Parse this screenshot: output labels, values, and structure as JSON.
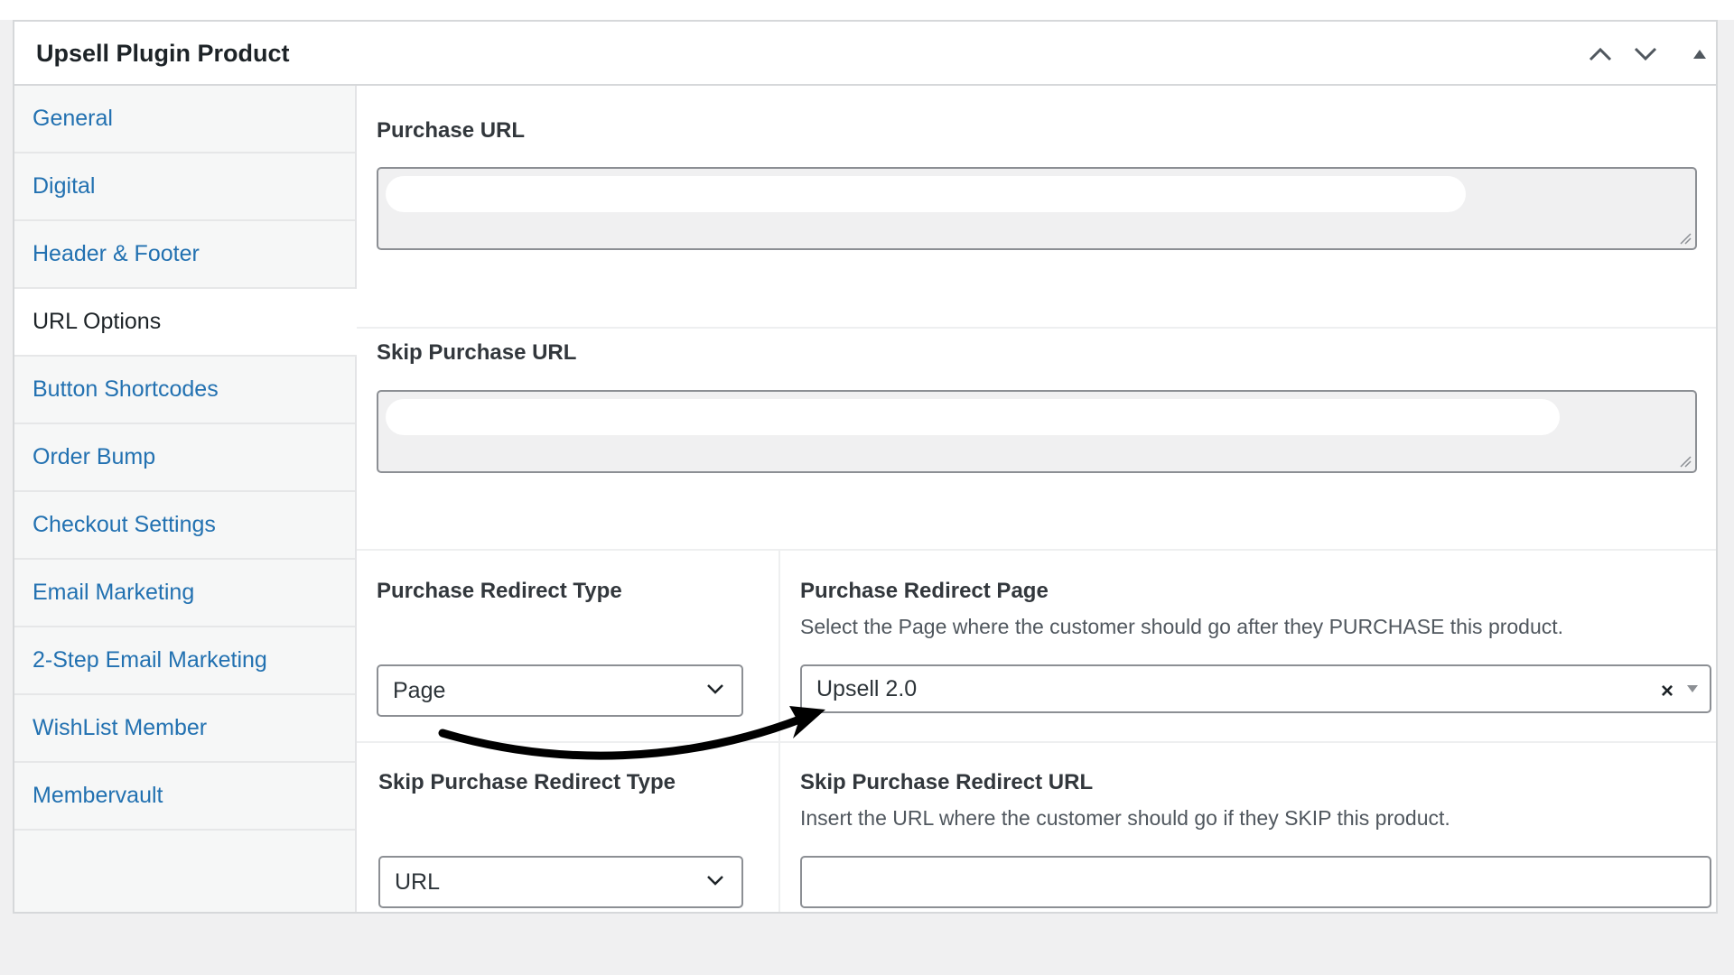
{
  "panel": {
    "title": "Upsell Plugin Product",
    "controls": [
      "move-up",
      "move-down",
      "toggle-panel"
    ]
  },
  "sidebar": {
    "tabs": [
      {
        "label": "General",
        "active": false
      },
      {
        "label": "Digital",
        "active": false
      },
      {
        "label": "Header & Footer",
        "active": false
      },
      {
        "label": "URL Options",
        "active": true
      },
      {
        "label": "Button Shortcodes",
        "active": false
      },
      {
        "label": "Order Bump",
        "active": false
      },
      {
        "label": "Checkout Settings",
        "active": false
      },
      {
        "label": "Email Marketing",
        "active": false
      },
      {
        "label": "2-Step Email Marketing",
        "active": false
      },
      {
        "label": "WishList Member",
        "active": false
      },
      {
        "label": "Membervault",
        "active": false
      }
    ]
  },
  "fields": {
    "purchase_url": {
      "label": "Purchase URL",
      "value": ""
    },
    "skip_purchase_url": {
      "label": "Skip Purchase URL",
      "value": ""
    },
    "purchase_redirect_type": {
      "label": "Purchase Redirect Type",
      "value": "Page"
    },
    "purchase_redirect_page": {
      "label": "Purchase Redirect Page",
      "description": "Select the Page where the customer should go after they PURCHASE this product.",
      "value": "Upsell 2.0",
      "clear_symbol": "×"
    },
    "skip_purchase_redirect_type": {
      "label": "Skip Purchase Redirect Type",
      "value": "URL"
    },
    "skip_purchase_redirect_url": {
      "label": "Skip Purchase Redirect URL",
      "description": "Insert the URL where the customer should go if they SKIP this product.",
      "value": ""
    }
  },
  "colors": {
    "link": "#2271b1",
    "text": "#1d2327",
    "border": "#8c8f94",
    "sidebar_bg": "#f6f7f7",
    "annotation_arrow": "#000000"
  },
  "icons": {
    "move_up": "chevron-up-icon",
    "move_down": "chevron-down-icon",
    "toggle": "triangle-up-icon",
    "select": "chevron-down-icon",
    "annotation": "curved-arrow-icon"
  }
}
